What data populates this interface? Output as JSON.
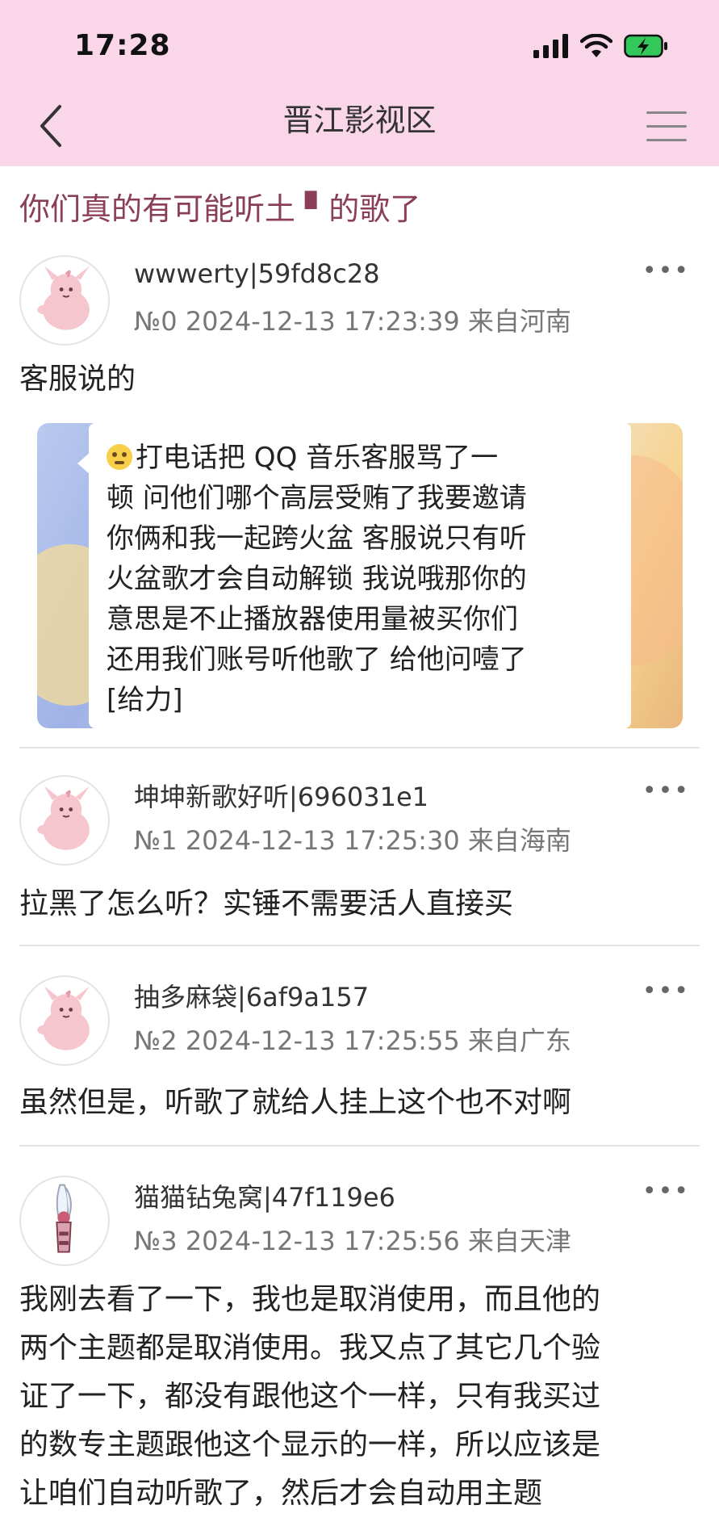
{
  "status_bar": {
    "time": "17:28"
  },
  "nav": {
    "title": "晋江影视区"
  },
  "thread": {
    "title": "你们真的有可能听土 ▘的歌了"
  },
  "posts": [
    {
      "username": "wwwerty|59fd8c28",
      "meta": "№0  2024-12-13 17:23:39 来自河南",
      "content": [
        "客服说的"
      ],
      "more": "•••"
    },
    {
      "username": "坤坤新歌好听|696031e1",
      "meta": "№1  2024-12-13 17:25:30 来自海南",
      "content": [
        "拉黑了怎么听？实锤不需要活人直接买"
      ],
      "more": "•••"
    },
    {
      "username": "抽多麻袋|6af9a157",
      "meta": "№2  2024-12-13 17:25:55 来自广东",
      "content": [
        "虽然但是，听歌了就给人挂上这个也不对啊"
      ],
      "more": "•••"
    },
    {
      "username": "猫猫钻兔窝|47f119e6",
      "meta": "№3  2024-12-13 17:25:56 来自天津",
      "content": [
        "我刚去看了一下，我也是取消使用，而且他的",
        "两个主题都是取消使用。我又点了其它几个验",
        "证了一下，都没有跟他这个一样，只有我买过",
        "的数专主题跟他这个显示的一样，所以应该是",
        "让咱们自动听歌了，然后才会自动用主题"
      ],
      "more": "•••"
    }
  ],
  "embed": {
    "lines": [
      "打电话把 QQ 音乐客服骂了一",
      "顿 问他们哪个高层受贿了我要邀请",
      "你俩和我一起跨火盆 客服说只有听",
      "火盆歌才会自动解锁 我说哦那你的",
      "意思是不止播放器使用量被买你们",
      "还用我们账号听他歌了 给他问噎了",
      "[给力]"
    ]
  },
  "icons": {
    "signal": "signal-icon",
    "wifi": "wifi-icon",
    "battery": "battery-charging-icon",
    "back": "back-chevron-icon",
    "menu": "hamburger-menu-icon",
    "more": "more-dots-icon",
    "emoji": "rolling-eyes-emoji-icon"
  },
  "colors": {
    "header_bg": "#f9d7e8",
    "thread_title": "#8a3e5a",
    "battery_green": "#34c759"
  }
}
